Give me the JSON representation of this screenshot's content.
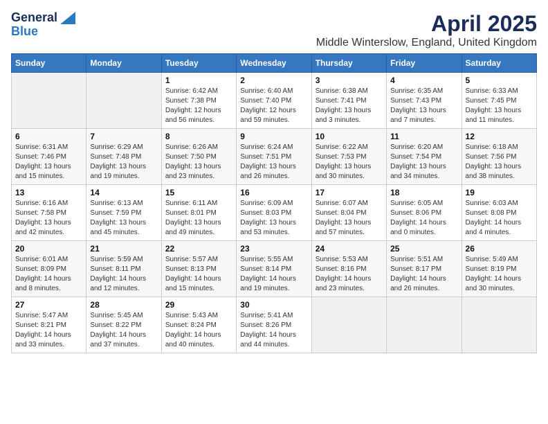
{
  "logo": {
    "general": "General",
    "blue": "Blue"
  },
  "title": "April 2025",
  "subtitle": "Middle Winterslow, England, United Kingdom",
  "weekdays": [
    "Sunday",
    "Monday",
    "Tuesday",
    "Wednesday",
    "Thursday",
    "Friday",
    "Saturday"
  ],
  "weeks": [
    [
      {
        "day": "",
        "sunrise": "",
        "sunset": "",
        "daylight": ""
      },
      {
        "day": "",
        "sunrise": "",
        "sunset": "",
        "daylight": ""
      },
      {
        "day": "1",
        "sunrise": "Sunrise: 6:42 AM",
        "sunset": "Sunset: 7:38 PM",
        "daylight": "Daylight: 12 hours and 56 minutes."
      },
      {
        "day": "2",
        "sunrise": "Sunrise: 6:40 AM",
        "sunset": "Sunset: 7:40 PM",
        "daylight": "Daylight: 12 hours and 59 minutes."
      },
      {
        "day": "3",
        "sunrise": "Sunrise: 6:38 AM",
        "sunset": "Sunset: 7:41 PM",
        "daylight": "Daylight: 13 hours and 3 minutes."
      },
      {
        "day": "4",
        "sunrise": "Sunrise: 6:35 AM",
        "sunset": "Sunset: 7:43 PM",
        "daylight": "Daylight: 13 hours and 7 minutes."
      },
      {
        "day": "5",
        "sunrise": "Sunrise: 6:33 AM",
        "sunset": "Sunset: 7:45 PM",
        "daylight": "Daylight: 13 hours and 11 minutes."
      }
    ],
    [
      {
        "day": "6",
        "sunrise": "Sunrise: 6:31 AM",
        "sunset": "Sunset: 7:46 PM",
        "daylight": "Daylight: 13 hours and 15 minutes."
      },
      {
        "day": "7",
        "sunrise": "Sunrise: 6:29 AM",
        "sunset": "Sunset: 7:48 PM",
        "daylight": "Daylight: 13 hours and 19 minutes."
      },
      {
        "day": "8",
        "sunrise": "Sunrise: 6:26 AM",
        "sunset": "Sunset: 7:50 PM",
        "daylight": "Daylight: 13 hours and 23 minutes."
      },
      {
        "day": "9",
        "sunrise": "Sunrise: 6:24 AM",
        "sunset": "Sunset: 7:51 PM",
        "daylight": "Daylight: 13 hours and 26 minutes."
      },
      {
        "day": "10",
        "sunrise": "Sunrise: 6:22 AM",
        "sunset": "Sunset: 7:53 PM",
        "daylight": "Daylight: 13 hours and 30 minutes."
      },
      {
        "day": "11",
        "sunrise": "Sunrise: 6:20 AM",
        "sunset": "Sunset: 7:54 PM",
        "daylight": "Daylight: 13 hours and 34 minutes."
      },
      {
        "day": "12",
        "sunrise": "Sunrise: 6:18 AM",
        "sunset": "Sunset: 7:56 PM",
        "daylight": "Daylight: 13 hours and 38 minutes."
      }
    ],
    [
      {
        "day": "13",
        "sunrise": "Sunrise: 6:16 AM",
        "sunset": "Sunset: 7:58 PM",
        "daylight": "Daylight: 13 hours and 42 minutes."
      },
      {
        "day": "14",
        "sunrise": "Sunrise: 6:13 AM",
        "sunset": "Sunset: 7:59 PM",
        "daylight": "Daylight: 13 hours and 45 minutes."
      },
      {
        "day": "15",
        "sunrise": "Sunrise: 6:11 AM",
        "sunset": "Sunset: 8:01 PM",
        "daylight": "Daylight: 13 hours and 49 minutes."
      },
      {
        "day": "16",
        "sunrise": "Sunrise: 6:09 AM",
        "sunset": "Sunset: 8:03 PM",
        "daylight": "Daylight: 13 hours and 53 minutes."
      },
      {
        "day": "17",
        "sunrise": "Sunrise: 6:07 AM",
        "sunset": "Sunset: 8:04 PM",
        "daylight": "Daylight: 13 hours and 57 minutes."
      },
      {
        "day": "18",
        "sunrise": "Sunrise: 6:05 AM",
        "sunset": "Sunset: 8:06 PM",
        "daylight": "Daylight: 14 hours and 0 minutes."
      },
      {
        "day": "19",
        "sunrise": "Sunrise: 6:03 AM",
        "sunset": "Sunset: 8:08 PM",
        "daylight": "Daylight: 14 hours and 4 minutes."
      }
    ],
    [
      {
        "day": "20",
        "sunrise": "Sunrise: 6:01 AM",
        "sunset": "Sunset: 8:09 PM",
        "daylight": "Daylight: 14 hours and 8 minutes."
      },
      {
        "day": "21",
        "sunrise": "Sunrise: 5:59 AM",
        "sunset": "Sunset: 8:11 PM",
        "daylight": "Daylight: 14 hours and 12 minutes."
      },
      {
        "day": "22",
        "sunrise": "Sunrise: 5:57 AM",
        "sunset": "Sunset: 8:13 PM",
        "daylight": "Daylight: 14 hours and 15 minutes."
      },
      {
        "day": "23",
        "sunrise": "Sunrise: 5:55 AM",
        "sunset": "Sunset: 8:14 PM",
        "daylight": "Daylight: 14 hours and 19 minutes."
      },
      {
        "day": "24",
        "sunrise": "Sunrise: 5:53 AM",
        "sunset": "Sunset: 8:16 PM",
        "daylight": "Daylight: 14 hours and 23 minutes."
      },
      {
        "day": "25",
        "sunrise": "Sunrise: 5:51 AM",
        "sunset": "Sunset: 8:17 PM",
        "daylight": "Daylight: 14 hours and 26 minutes."
      },
      {
        "day": "26",
        "sunrise": "Sunrise: 5:49 AM",
        "sunset": "Sunset: 8:19 PM",
        "daylight": "Daylight: 14 hours and 30 minutes."
      }
    ],
    [
      {
        "day": "27",
        "sunrise": "Sunrise: 5:47 AM",
        "sunset": "Sunset: 8:21 PM",
        "daylight": "Daylight: 14 hours and 33 minutes."
      },
      {
        "day": "28",
        "sunrise": "Sunrise: 5:45 AM",
        "sunset": "Sunset: 8:22 PM",
        "daylight": "Daylight: 14 hours and 37 minutes."
      },
      {
        "day": "29",
        "sunrise": "Sunrise: 5:43 AM",
        "sunset": "Sunset: 8:24 PM",
        "daylight": "Daylight: 14 hours and 40 minutes."
      },
      {
        "day": "30",
        "sunrise": "Sunrise: 5:41 AM",
        "sunset": "Sunset: 8:26 PM",
        "daylight": "Daylight: 14 hours and 44 minutes."
      },
      {
        "day": "",
        "sunrise": "",
        "sunset": "",
        "daylight": ""
      },
      {
        "day": "",
        "sunrise": "",
        "sunset": "",
        "daylight": ""
      },
      {
        "day": "",
        "sunrise": "",
        "sunset": "",
        "daylight": ""
      }
    ]
  ]
}
